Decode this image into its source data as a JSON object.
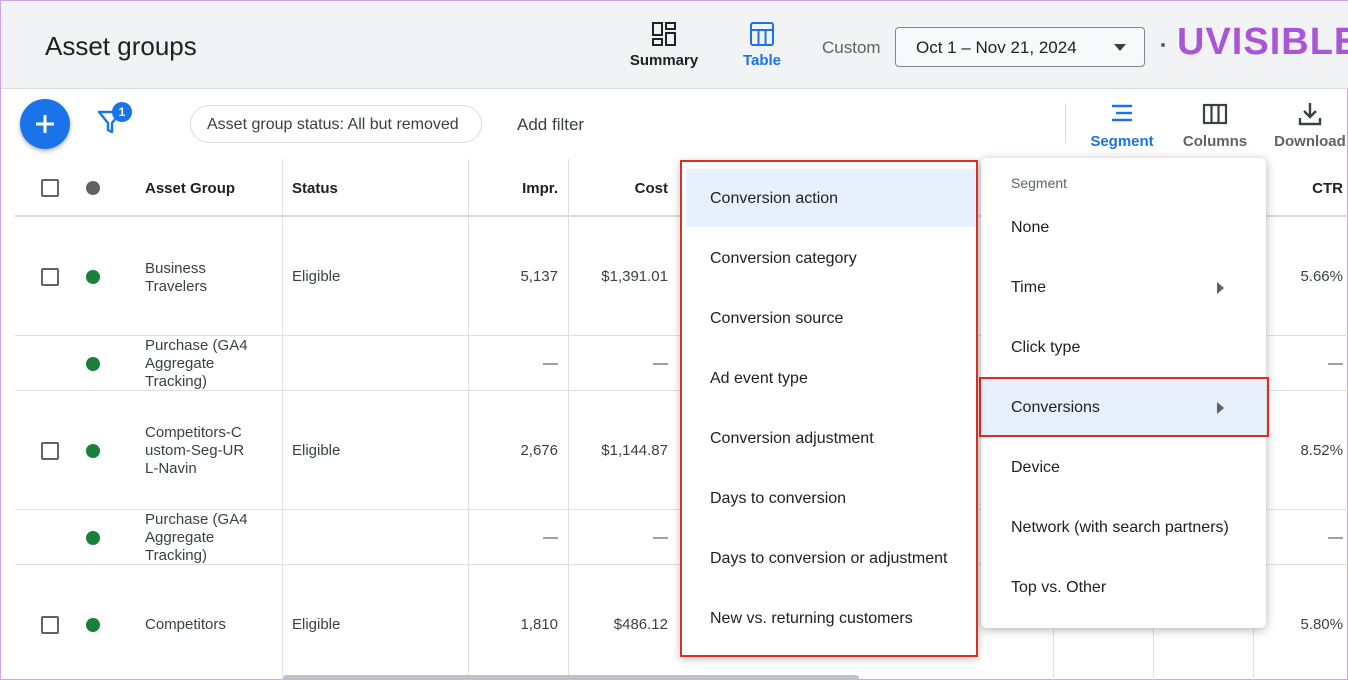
{
  "header": {
    "title": "Asset groups",
    "views": [
      {
        "label": "Summary",
        "icon": "summary-icon"
      },
      {
        "label": "Table",
        "icon": "table-icon"
      }
    ],
    "date_range_label": "Custom",
    "date_range_value": "Oct 1 – Nov 21, 2024",
    "brand": "UVISIBLE",
    "colors": {
      "accent": "#1a73e8",
      "brand": "#a855d6",
      "highlight": "#d93025",
      "eligible": "#188038"
    }
  },
  "toolbar": {
    "filter_count": "1",
    "status_filter": "Asset group status: All but removed",
    "add_filter": "Add filter",
    "segment_label": "Segment",
    "columns_label": "Columns",
    "download_label": "Download"
  },
  "table": {
    "headers": {
      "asset_group": "Asset Group",
      "status": "Status",
      "impr": "Impr.",
      "cost": "Cost",
      "ctr": "CTR"
    },
    "rows": [
      {
        "name": "Business Travelers",
        "status": "Eligible",
        "impr": "5,137",
        "cost": "$1,391.01",
        "ctr": "5.66%"
      },
      {
        "name": "Purchase (GA4 Aggregate Tracking)",
        "status": "",
        "impr": "—",
        "cost": "—",
        "ctr": "—"
      },
      {
        "name": "Competitors-Custom-Seg-URL-Navin",
        "status": "Eligible",
        "impr": "2,676",
        "cost": "$1,144.87",
        "ctr": "8.52%"
      },
      {
        "name": "Purchase (GA4 Aggregate Tracking)",
        "status": "",
        "impr": "—",
        "cost": "—",
        "ctr": "—"
      },
      {
        "name": "Competitors",
        "status": "Eligible",
        "impr": "1,810",
        "cost": "$486.12",
        "ctr": "5.80%"
      }
    ]
  },
  "segment_menu": {
    "title": "Segment",
    "items": [
      "None",
      "Time",
      "Click type",
      "Conversions",
      "Device",
      "Network (with search partners)",
      "Top vs. Other"
    ]
  },
  "conversions_submenu": {
    "items": [
      "Conversion action",
      "Conversion category",
      "Conversion source",
      "Ad event type",
      "Conversion adjustment",
      "Days to conversion",
      "Days to conversion or adjustment",
      "New vs. returning customers"
    ]
  }
}
